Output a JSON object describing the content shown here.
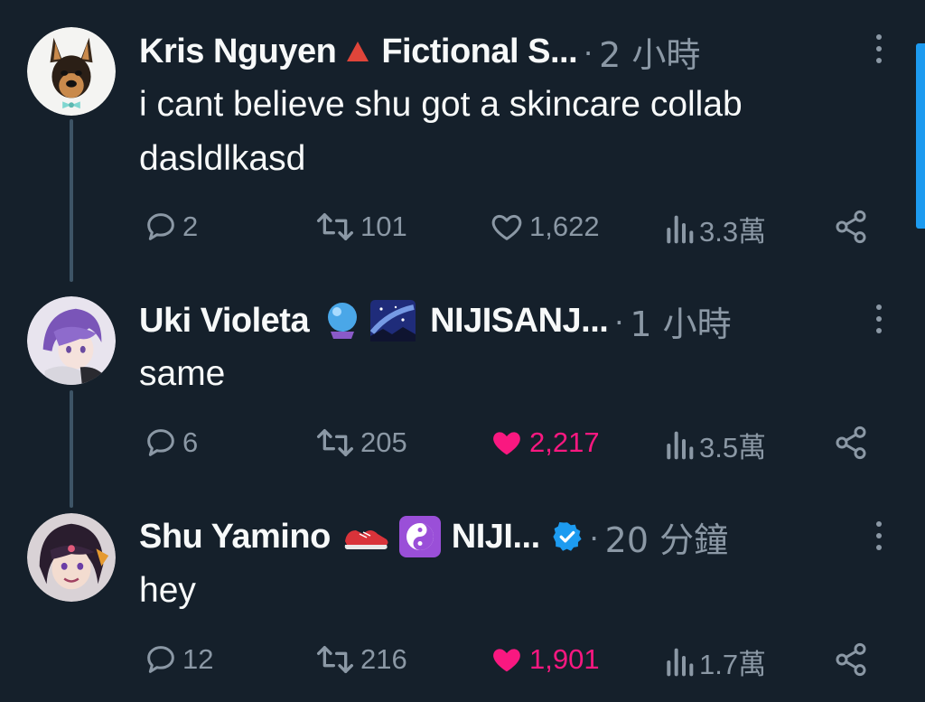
{
  "tweets": [
    {
      "name": "Kris Nguyen",
      "affiliation": "Fictional S...",
      "separator": "·",
      "time": "2 小時",
      "text_lines": [
        "i cant believe shu got a skincare collab",
        "dasldlkasd"
      ],
      "replies": "2",
      "retweets": "101",
      "likes": "1,622",
      "views": "3.3萬",
      "liked": false
    },
    {
      "name": "Uki Violeta",
      "affiliation": "NIJISANJ...",
      "separator": "·",
      "time": "1 小時",
      "text_lines": [
        "same"
      ],
      "replies": "6",
      "retweets": "205",
      "likes": "2,217",
      "views": "3.5萬",
      "liked": true
    },
    {
      "name": "Shu Yamino",
      "affiliation": "NIJI...",
      "separator": "·",
      "time": "20 分鐘",
      "text_lines": [
        "hey"
      ],
      "replies": "12",
      "retweets": "216",
      "likes": "1,901",
      "views": "1.7萬",
      "liked": true,
      "verified": true
    }
  ],
  "colors": {
    "background": "#15202b",
    "text": "#f7f9f9",
    "muted": "#8b98a5",
    "like_active": "#f91880",
    "verified": "#1d9bf0",
    "thread_line": "#3d5466"
  },
  "icons": [
    "reply-icon",
    "retweet-icon",
    "like-icon",
    "views-icon",
    "share-icon",
    "more-options-icon"
  ]
}
